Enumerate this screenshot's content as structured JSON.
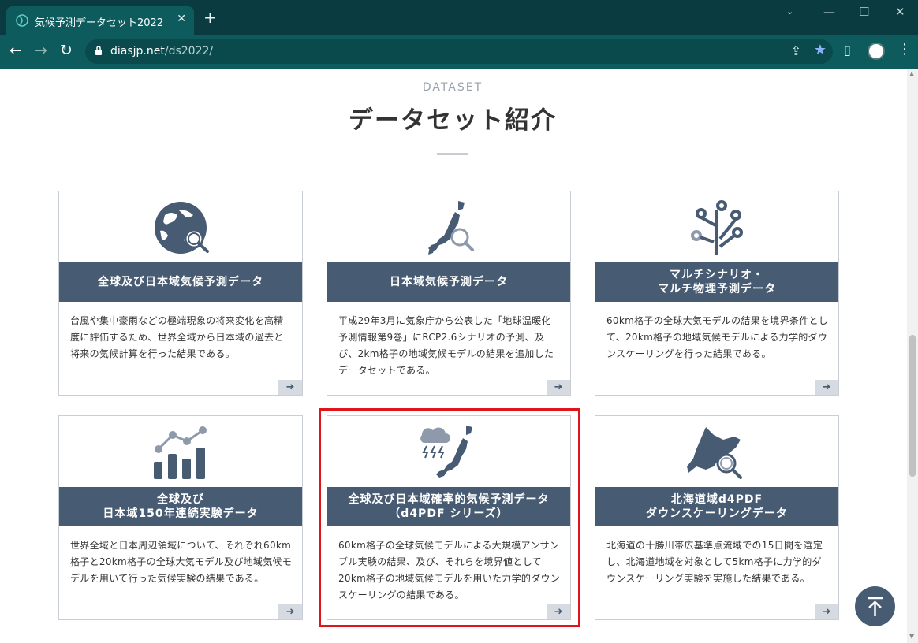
{
  "browser": {
    "tab_title": "気候予測データセット2022",
    "tab_close": "✕",
    "new_tab": "+",
    "url_host": "diasjp.net",
    "url_path": "/ds2022/",
    "back": "←",
    "forward": "→",
    "reload": "↻",
    "minimize": "—",
    "maximize": "☐",
    "close": "✕",
    "menu": "⋮"
  },
  "section": {
    "eyebrow": "DATASET",
    "heading": "データセット紹介"
  },
  "cards": [
    {
      "title": "全球及び日本域気候予測データ",
      "desc": "台風や集中豪雨などの極端現象の将来変化を高精度に評価するため、世界全域から日本域の過去と将来の気候計算を行った結果である。",
      "icon": "globe-search-icon",
      "arrow": "➜"
    },
    {
      "title": "日本域気候予測データ",
      "desc": "平成29年3月に気象庁から公表した「地球温暖化予測情報第9巻」にRCP2.6シナリオの予測、及び、2km格子の地域気候モデルの結果を追加したデータセットである。",
      "icon": "japan-map-search-icon",
      "arrow": "➜"
    },
    {
      "title": "マルチシナリオ・\nマルチ物理予測データ",
      "desc": "60km格子の全球大気モデルの結果を境界条件として、20km格子の地域気候モデルによる力学的ダウンスケーリングを行った結果である。",
      "icon": "circuit-tree-icon",
      "arrow": "➜"
    },
    {
      "title": "全球及び\n日本域150年連続実験データ",
      "desc": "世界全域と日本周辺領域について、それぞれ60km格子と20km格子の全球大気モデル及び地域気候モデルを用いて行った気候実験の結果である。",
      "icon": "bar-line-chart-icon",
      "arrow": "➜"
    },
    {
      "title": "全球及び日本域確率的気候予測データ\n（d4PDF シリーズ）",
      "desc": "60km格子の全球気候モデルによる大規模アンサンブル実験の結果、及び、それらを境界値として20km格子の地域気候モデルを用いた力学的ダウンスケーリングの結果である。",
      "icon": "storm-cloud-japan-icon",
      "arrow": "➜"
    },
    {
      "title": "北海道域d4PDF\nダウンスケーリングデータ",
      "desc": "北海道の十勝川帯広基準点流域での15日間を選定し、北海道地域を対象として5km格子に力学的ダウンスケーリング実験を実施した結果である。",
      "icon": "hokkaido-map-search-icon",
      "arrow": "➜"
    }
  ],
  "colors": {
    "card_header": "#475b73",
    "highlight": "#e0151c",
    "browser_frame": "#0a3b40"
  }
}
